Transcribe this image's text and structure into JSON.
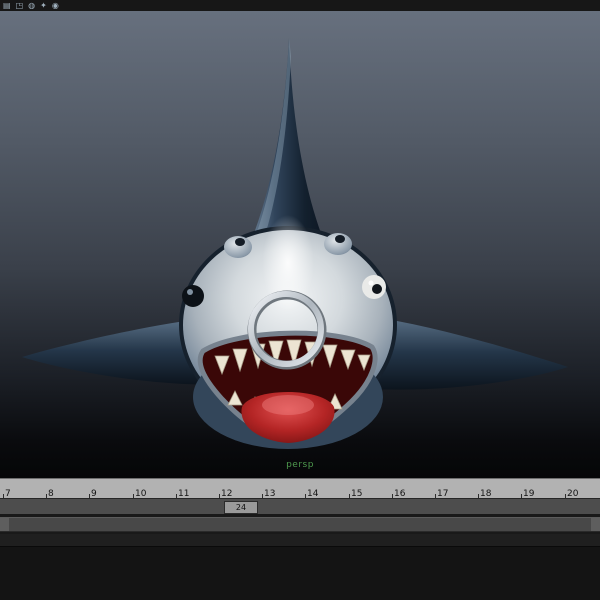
{
  "toolbar": {
    "icons": [
      {
        "name": "panel-menu-icon",
        "glyph": "▤"
      },
      {
        "name": "cube-icon",
        "glyph": "◳"
      },
      {
        "name": "sphere-icon",
        "glyph": "◍"
      },
      {
        "name": "light-icon",
        "glyph": "✦"
      },
      {
        "name": "camera-icon",
        "glyph": "◉"
      }
    ]
  },
  "viewport": {
    "camera_label": "persp",
    "model": "cartoon-shark-with-nose-ring"
  },
  "timeline": {
    "frames": [
      "7",
      "8",
      "9",
      "10",
      "11",
      "12",
      "13",
      "14",
      "15",
      "16",
      "17",
      "18",
      "19",
      "20"
    ],
    "current_frame": "24"
  },
  "colors": {
    "camera_label_green": "#4e9a4e",
    "viewport_top": "#67707e",
    "viewport_bottom": "#050607",
    "timeline_bg": "#b2b2b2"
  }
}
